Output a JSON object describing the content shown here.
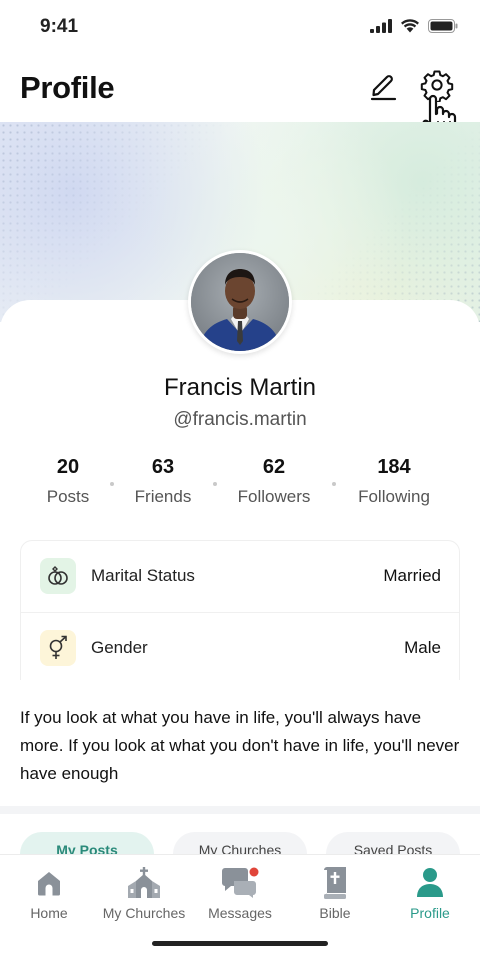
{
  "status_bar": {
    "time": "9:41"
  },
  "header": {
    "title": "Profile"
  },
  "profile": {
    "name": "Francis Martin",
    "handle": "@francis.martin"
  },
  "stats": [
    {
      "value": "20",
      "label": "Posts"
    },
    {
      "value": "63",
      "label": "Friends"
    },
    {
      "value": "62",
      "label": "Followers"
    },
    {
      "value": "184",
      "label": "Following"
    }
  ],
  "info": [
    {
      "label": "Marital Status",
      "value": "Married",
      "icon": "rings-icon",
      "icon_bg": "#e3f4e6"
    },
    {
      "label": "Gender",
      "value": "Male",
      "icon": "gender-icon",
      "icon_bg": "#fdf5d9"
    }
  ],
  "bio": "If you look at what you have in life, you'll always have more. If you look at what you don't have in life, you'll never have enough",
  "tabs": [
    {
      "label": "My Posts",
      "active": true
    },
    {
      "label": "My Churches",
      "active": false
    },
    {
      "label": "Saved Posts",
      "active": false
    }
  ],
  "bottom_nav": [
    {
      "label": "Home",
      "icon": "home-icon"
    },
    {
      "label": "My Churches",
      "icon": "church-icon"
    },
    {
      "label": "Messages",
      "icon": "messages-icon"
    },
    {
      "label": "Bible",
      "icon": "bible-icon"
    },
    {
      "label": "Profile",
      "icon": "profile-icon",
      "active": true
    }
  ],
  "colors": {
    "accent": "#2a9a8a",
    "nav_icon": "#8a9199",
    "notification": "#e0453a"
  }
}
